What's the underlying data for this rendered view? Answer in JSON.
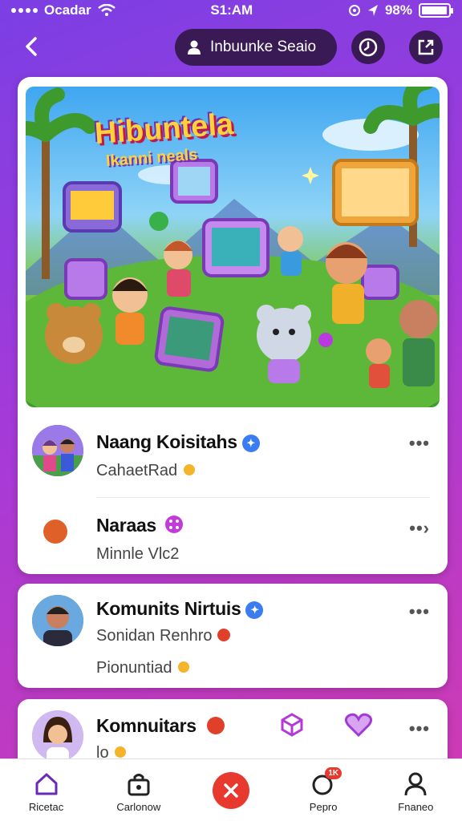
{
  "status": {
    "carrier": "Ocadar",
    "time": "S1:AM",
    "battery": "98%",
    "battery_level": 0.98
  },
  "header": {
    "community_label": "Inbuunke Seaio"
  },
  "hero": {
    "title": "Hibuntela",
    "subtitle": "Ikanni neals"
  },
  "feed": [
    {
      "name": "Naang Koisitahs",
      "sub": "CahaetRad",
      "more": "•••"
    },
    {
      "name": "Naraas",
      "sub": "Minnle Vlc2",
      "more": "••›"
    },
    {
      "name": "Komunits Nirtuis",
      "sub": "Sonidan Renhro",
      "sub2": "Pionuntiad",
      "more": "•••"
    },
    {
      "name": "Komnuitars",
      "sub": "lo",
      "more": "•••"
    }
  ],
  "bottom_nav": [
    {
      "label": "Ricetac",
      "icon": "home-icon"
    },
    {
      "label": "Carlonow",
      "icon": "bag-icon"
    },
    {
      "label": "",
      "icon": "close-icon"
    },
    {
      "label": "Pepro",
      "icon": "notification-icon",
      "badge": "1K"
    },
    {
      "label": "Fnaneo",
      "icon": "profile-icon"
    }
  ],
  "colors": {
    "accent": "#e8392f",
    "pill": "#3a1a55",
    "verified": "#3b7df0"
  }
}
